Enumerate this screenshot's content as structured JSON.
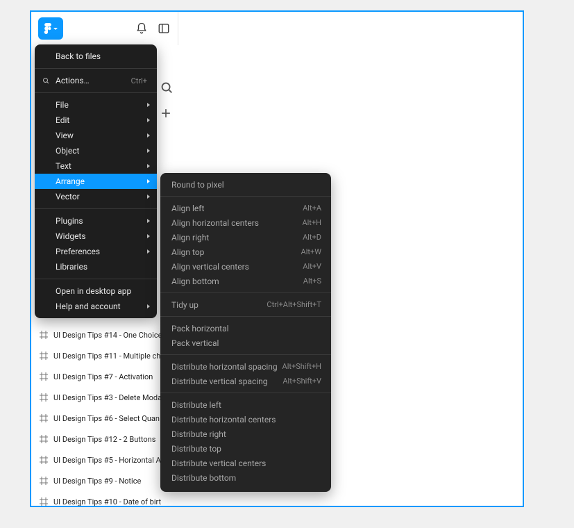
{
  "mainMenu": {
    "back": "Back to files",
    "actions": "Actions…",
    "actionsShortcut": "Ctrl+",
    "file": "File",
    "edit": "Edit",
    "view": "View",
    "object": "Object",
    "text": "Text",
    "arrange": "Arrange",
    "vector": "Vector",
    "plugins": "Plugins",
    "widgets": "Widgets",
    "preferences": "Preferences",
    "libraries": "Libraries",
    "desktop": "Open in desktop app",
    "help": "Help and account"
  },
  "arrangeMenu": {
    "roundPixel": "Round to pixel",
    "alignLeft": "Align left",
    "alignLeftK": "Alt+A",
    "alignHC": "Align horizontal centers",
    "alignHCK": "Alt+H",
    "alignRight": "Align right",
    "alignRightK": "Alt+D",
    "alignTop": "Align top",
    "alignTopK": "Alt+W",
    "alignVC": "Align vertical centers",
    "alignVCK": "Alt+V",
    "alignBottom": "Align bottom",
    "alignBottomK": "Alt+S",
    "tidy": "Tidy up",
    "tidyK": "Ctrl+Alt+Shift+T",
    "packH": "Pack horizontal",
    "packV": "Pack vertical",
    "distHS": "Distribute horizontal spacing",
    "distHSK": "Alt+Shift+H",
    "distVS": "Distribute vertical spacing",
    "distVSK": "Alt+Shift+V",
    "distLeft": "Distribute left",
    "distHC": "Distribute horizontal centers",
    "distRight": "Distribute right",
    "distTop": "Distribute top",
    "distVC": "Distribute vertical centers",
    "distBottom": "Distribute bottom"
  },
  "layers": {
    "r1": "UI Design Tips #14 - One Choice",
    "r2": "UI Design Tips #11 - Multiple ch",
    "r3": "UI Design Tips #7 - Activation",
    "r4": "UI Design Tips #3 - Delete Moda",
    "r5": "UI Design Tips #6 - Select Quan",
    "r6": "UI Design Tips #12 - 2 Buttons",
    "r7": "UI Design Tips #5 - Horizontal A",
    "r8": "UI Design Tips #9 - Notice",
    "r9": "UI Design Tips #10 - Date of birt"
  }
}
